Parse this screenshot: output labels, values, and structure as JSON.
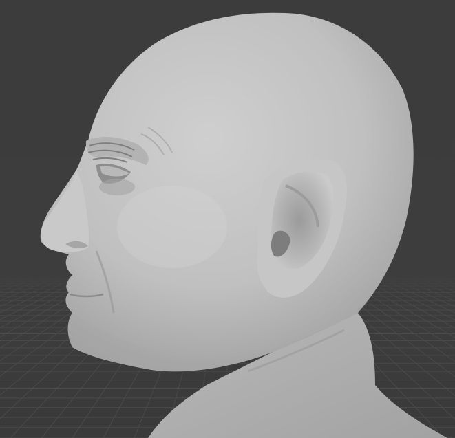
{
  "viewport": {
    "background_color": "#3d3d3d",
    "grid_color": "#4a4a4a",
    "mesh_color": "#bfbfbf",
    "mesh_shadow_color": "#8a8a8a",
    "mesh_highlight_color": "#d6d6d6"
  },
  "scene": {
    "object_icon": "sculpt-mesh-icon",
    "floor_icon": "floor-grid-icon"
  }
}
